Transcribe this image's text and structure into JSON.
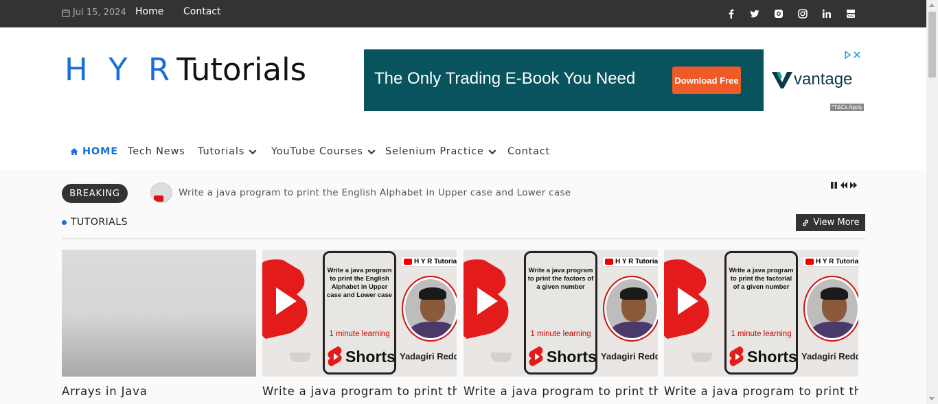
{
  "topbar": {
    "date": "Jul 15, 2024",
    "links": [
      "Home",
      "Contact"
    ],
    "social_icons": [
      "facebook-icon",
      "twitter-icon",
      "github-icon",
      "instagram-icon",
      "linkedin-icon",
      "youtube-icon"
    ]
  },
  "logo": {
    "part1": "H Y R",
    "part2": "Tutorials"
  },
  "ad": {
    "headline": "The Only Trading E-Book You Need",
    "cta": "Download Free",
    "brand": "vantage",
    "disclaimer": "*T&Cs Apply"
  },
  "nav": {
    "home": "HOME",
    "items": [
      "Tech News",
      "Tutorials",
      "YouTube Courses",
      "Selenium Practice",
      "Contact"
    ]
  },
  "breaking": {
    "label": "BREAKING",
    "text": "Write a java program to print the English Alphabet in Upper case and Lower case"
  },
  "section": {
    "title": "TUTORIALS",
    "view_more": "View More"
  },
  "cards": [
    {
      "title": "Arrays in Java"
    },
    {
      "title": "Write a java program to print the English Alphabet in Upper case and Lower case",
      "thumb_text": "Write a java program to print the English Alphabet in Upper case and Lower case",
      "minute": "1 minute learning",
      "shorts": "Shorts",
      "channel": "H Y R Tutorials",
      "author": "Yadagiri Reddy"
    },
    {
      "title": "Write a java program to print the factors of a given number",
      "thumb_text": "Write a java program to print the factors of a given number",
      "minute": "1 minute learning",
      "shorts": "Shorts",
      "channel": "H Y R Tutorials",
      "author": "Yadagiri Reddy"
    },
    {
      "title": "Write a java program to print the factorial of a given number",
      "thumb_text": "Write a java program to print the factorial of a given number",
      "minute": "1 minute learning",
      "shorts": "Shorts",
      "channel": "H Y R Tutorials",
      "author": "Yadagiri Reddy"
    }
  ],
  "colors": {
    "topbar": "#333333",
    "accent": "#1a6fd6",
    "ad_bg": "#08535d",
    "ad_cta": "#ee5a28"
  }
}
